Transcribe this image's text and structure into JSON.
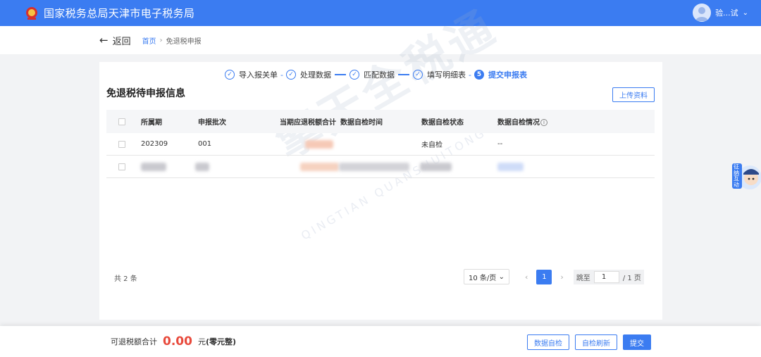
{
  "header": {
    "site_title": "国家税务总局天津市电子税务局",
    "user_name": "验...试",
    "user_menu_icon": "chevron-down-icon",
    "logo_icon": "tax-emblem-icon"
  },
  "breadcrumb": {
    "back_label": "返回",
    "home": "首页",
    "current": "免退税申报"
  },
  "steps": [
    {
      "label": "导入报关单",
      "state": "done"
    },
    {
      "label": "处理数据",
      "state": "done"
    },
    {
      "label": "匹配数据",
      "state": "done"
    },
    {
      "label": "填写明细表",
      "state": "done"
    },
    {
      "label": "提交申报表",
      "state": "active",
      "number": "5"
    }
  ],
  "panel": {
    "title": "免退税待申报信息",
    "upload_label": "上传资料"
  },
  "table": {
    "headers": {
      "period": "所属期",
      "batch": "申报批次",
      "amount": "当期应退税额合计",
      "check_time": "数据自检时间",
      "check_status": "数据自检状态",
      "check_result": "数据自检情况"
    },
    "rows": [
      {
        "period": "202309",
        "batch": "001",
        "amount": "",
        "check_time": "",
        "check_status": "未自检",
        "check_result": "--"
      },
      {
        "period": "",
        "batch": "",
        "amount": "",
        "check_time": "",
        "check_status": "",
        "check_result": ""
      }
    ]
  },
  "pagination": {
    "total": "共 2 条",
    "page_size": "10 条/页",
    "current_page": "1",
    "jump_label": "跳至",
    "jump_value": "1",
    "total_pages": "/ 1 页"
  },
  "watermark": {
    "main": "擎天全税通",
    "sub": "QINGTIAN QUANSHUITONG"
  },
  "footer": {
    "label": "可退税额合计",
    "amount": "0.00",
    "unit": "元",
    "amount_words": "(零元整)",
    "check_button": "数据自检",
    "refresh_button": "自检刷新",
    "submit_button": "提交"
  },
  "helper": {
    "label": "征纳互动"
  },
  "colors": {
    "primary": "#3b7cf1",
    "amount": "#e84a3c"
  }
}
